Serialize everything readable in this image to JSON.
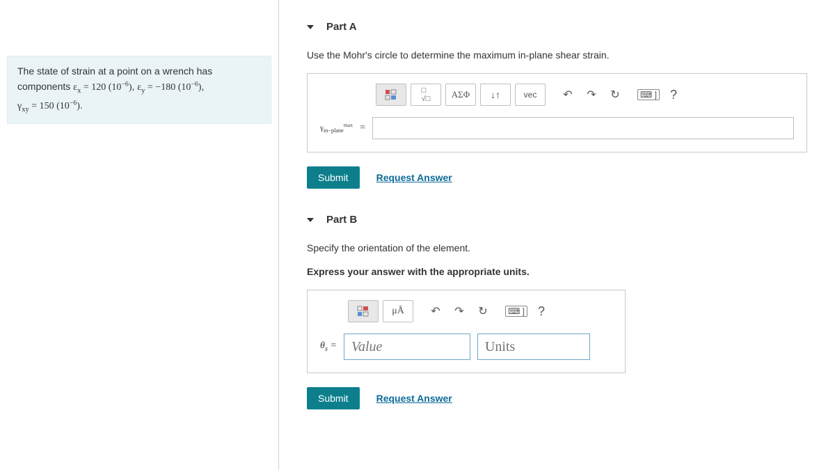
{
  "problem": {
    "line1": "The state of strain at a point on a wrench has",
    "line2_prefix": "components ",
    "ex_eq": "ε<sub>x</sub> = 120 (10<sup>−6</sup>)",
    "sep1": ", ",
    "ey_eq": "ε<sub>y</sub> = −180 (10<sup>−6</sup>)",
    "sep2": ",",
    "line3_eq": "γ<sub>xy</sub> = 150 (10<sup>−6</sup>)",
    "period": "."
  },
  "partA": {
    "title": "Part A",
    "instruction": "Use the Mohr's circle to determine the maximum in-plane shear strain.",
    "toolbar": {
      "template": "template-icon",
      "fraction": "fraction-icon",
      "greek": "ΑΣΦ",
      "arrows": "↓↑",
      "vec": "vec",
      "undo": "↶",
      "redo": "↷",
      "reset": "↻",
      "keyboard": "⌨ ]",
      "help": "?"
    },
    "eq_label_html": "γ<sub>in−plane</sub><sup>max</sup>",
    "eq_sign": "=",
    "submit": "Submit",
    "request": "Request Answer"
  },
  "partB": {
    "title": "Part B",
    "instruction1": "Specify the orientation of the element.",
    "instruction2": "Express your answer with the appropriate units.",
    "toolbar": {
      "template": "template-icon",
      "units": "μÅ",
      "undo": "↶",
      "redo": "↷",
      "reset": "↻",
      "keyboard": "⌨ ]",
      "help": "?"
    },
    "eq_label": "θ",
    "eq_sub": "s",
    "eq_sign": " = ",
    "value_ph": "Value",
    "units_ph": "Units",
    "submit": "Submit",
    "request": "Request Answer"
  }
}
